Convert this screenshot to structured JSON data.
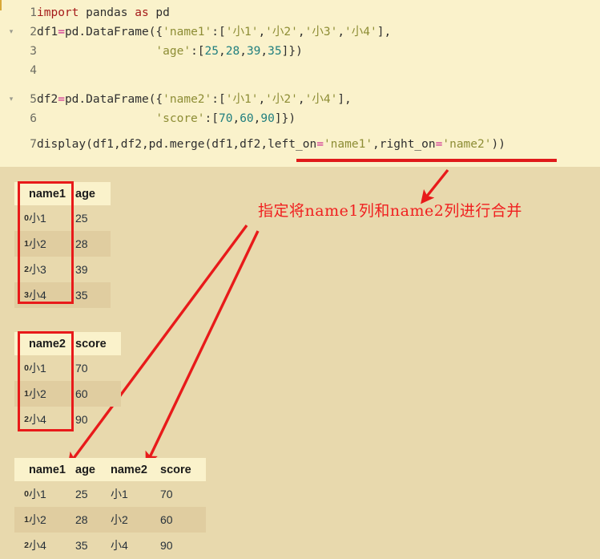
{
  "notebook": {
    "cell_marker_color": "#d8a838",
    "code_bg": "#faf2cb",
    "page_bg": "#e8d9ad",
    "accent_red": "#e81a1a",
    "fold_glyph": "▾",
    "code_lines": [
      {
        "num": "1",
        "foldable": false
      },
      {
        "num": "2",
        "foldable": true
      },
      {
        "num": "3",
        "foldable": false
      },
      {
        "num": "4",
        "foldable": false
      },
      {
        "num": "5",
        "foldable": true
      },
      {
        "num": "6",
        "foldable": false
      },
      {
        "num": "7",
        "foldable": false
      }
    ],
    "code_text": [
      "import pandas as pd",
      "df1=pd.DataFrame({'name1':['小1','小2','小3','小4'],",
      "                  'age':[25,28,39,35]})",
      "",
      "df2=pd.DataFrame({'name2':['小1','小2','小4'],",
      "                  'score':[70,60,90]})",
      "display(df1,df2,pd.merge(df1,df2,left_on='name1',right_on='name2'))"
    ]
  },
  "annotation": {
    "text": "指定将name1列和name2列进行合并",
    "color": "#f02020",
    "underline_target": "left_on='name1',right_on='name2'",
    "arrow_count": 3
  },
  "tables": [
    {
      "name": "df1",
      "columns": [
        "name1",
        "age"
      ],
      "index": [
        "0",
        "1",
        "2",
        "3"
      ],
      "rows": [
        [
          "小1",
          "25"
        ],
        [
          "小2",
          "28"
        ],
        [
          "小3",
          "39"
        ],
        [
          "小4",
          "35"
        ]
      ],
      "highlighted_column": "name1"
    },
    {
      "name": "df2",
      "columns": [
        "name2",
        "score"
      ],
      "index": [
        "0",
        "1",
        "2"
      ],
      "rows": [
        [
          "小1",
          "70"
        ],
        [
          "小2",
          "60"
        ],
        [
          "小4",
          "90"
        ]
      ],
      "highlighted_column": "name2"
    },
    {
      "name": "merged",
      "columns": [
        "name1",
        "age",
        "name2",
        "score"
      ],
      "index": [
        "0",
        "1",
        "2"
      ],
      "rows": [
        [
          "小1",
          "25",
          "小1",
          "70"
        ],
        [
          "小2",
          "28",
          "小2",
          "60"
        ],
        [
          "小4",
          "35",
          "小4",
          "90"
        ]
      ],
      "highlighted_column": null
    }
  ]
}
